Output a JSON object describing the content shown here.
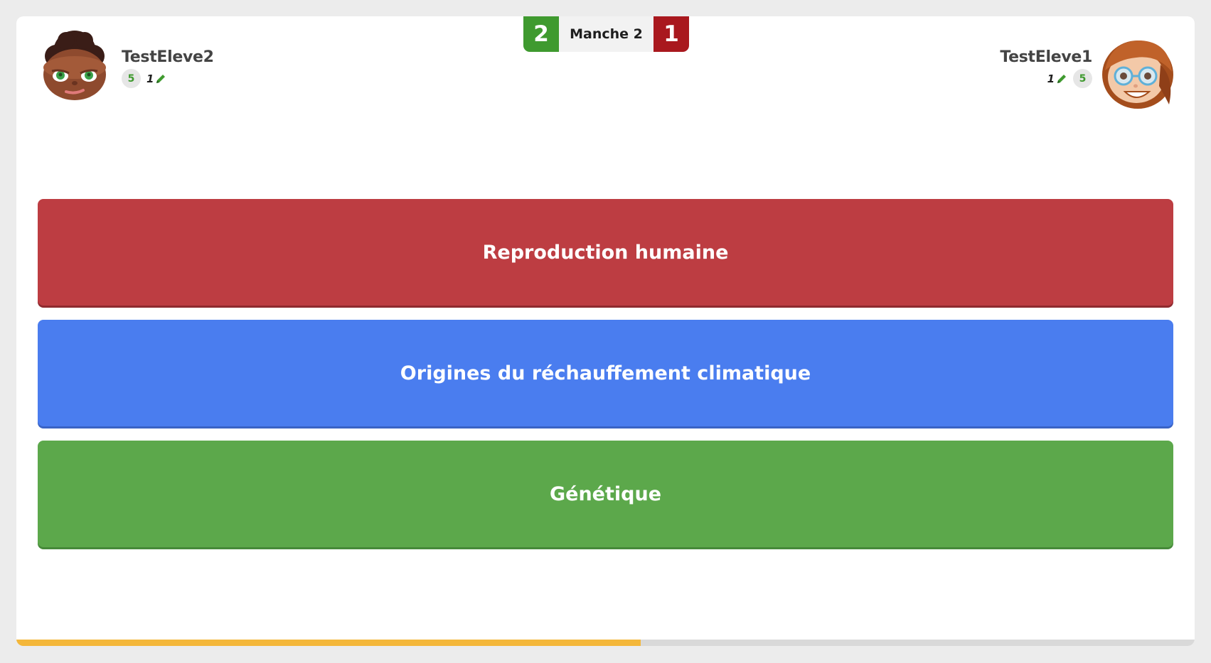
{
  "round": {
    "label": "Manche 2",
    "score_left": "2",
    "score_right": "1"
  },
  "player_left": {
    "name": "TestEleve2",
    "level": "5",
    "pens": "1",
    "avatar": "boy-curly-hair-avatar"
  },
  "player_right": {
    "name": "TestEleve1",
    "level": "5",
    "pens": "1",
    "avatar": "girl-glasses-avatar"
  },
  "choices": [
    {
      "label": "Reproduction humaine",
      "color": "#bd3d42"
    },
    {
      "label": "Origines du réchauffement climatique",
      "color": "#4a7def"
    },
    {
      "label": "Génétique",
      "color": "#5ca84b"
    }
  ],
  "timer": {
    "progress": 0.53,
    "color": "#f4b73a"
  },
  "colors": {
    "win": "#3f9a2f",
    "lose": "#a9181e"
  }
}
